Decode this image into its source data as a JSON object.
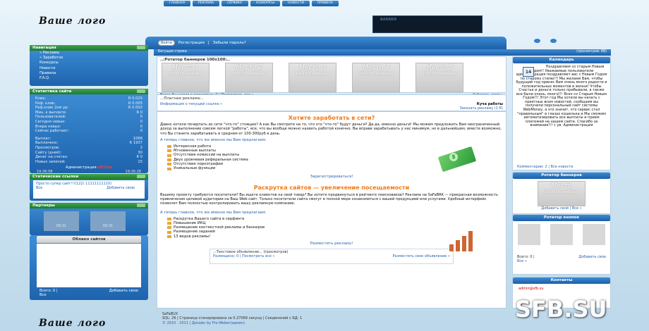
{
  "topnav": [
    "ГЛАВНАЯ",
    "РЕКЛАМА",
    "СЁРФИНГ",
    "КОНКУРСЫ",
    "НОВОСТИ",
    "ПРАВИЛА"
  ],
  "logo": "Ваше лого",
  "banner": "BANNER",
  "auth": {
    "login_btn": "Войти",
    "register": "Регистрация",
    "forgot": "Забыли пароль?"
  },
  "ticker": {
    "left": "Бегущая строка",
    "right": "(просмотров: 88)"
  },
  "nav": {
    "title": "Навигация",
    "items": [
      "» Реклама",
      "» Заработок",
      "Конкурсы",
      "Новости",
      "Правила",
      "F.A.Q."
    ]
  },
  "stats": {
    "title": "Статистика сайта",
    "rows": [
      [
        "Клик:",
        "R 0.025"
      ],
      [
        "Реф. клик:",
        "R 0.005"
      ],
      [
        "Реф.клик 2ом ур:",
        "R 0.002"
      ],
      [
        "Мин. к выплате:",
        "R 0"
      ],
      [
        "Пользователей:",
        "0"
      ],
      [
        "Сегодня новых:",
        "0"
      ],
      [
        "Вчера новых:",
        "0"
      ],
      [
        "Сейчас работает:",
        "0"
      ],
      [
        "Выплат:",
        "1066"
      ],
      [
        "Выплачено:",
        "R 1937"
      ],
      [
        "Просмотров:",
        "2"
      ],
      [
        "Сайту (дней):",
        "30"
      ],
      [
        "Денег на счетах:",
        "R 0"
      ],
      [
        "Новых записей:",
        "15"
      ]
    ],
    "admin_label": "Администрация",
    "admin_status": "off-line",
    "time_left": "19:36:58",
    "time_right": "19:26:28"
  },
  "static_links": {
    "title": "Статические ссылки",
    "link": "Просто супер сайт!!!(122) 11111111110)",
    "all": "Все",
    "add": "Добавить свою"
  },
  "partners": {
    "title": "Партнеры",
    "counter": "00:31"
  },
  "cloud": {
    "title": "Облако сайтов",
    "total": "Всего: 0 |",
    "all": "Все",
    "add": "Добавить свою"
  },
  "rotator": {
    "title": "..:Ротатор баннеров 100х100:..",
    "places": [
      "Место 1",
      "Место 2",
      "Место 3",
      "Место 4",
      "Место 5"
    ],
    "place_note": "100x100 свободно",
    "total": "Всего баннеров в ротаторах: 0 | Посмотреть все »",
    "add": "Добавить свой »"
  },
  "paid": {
    "title": "..:Платная реклама:..",
    "link": "Информация о текущей ссылке »",
    "right_title": "Куча работы",
    "order": "Заказать рекламу (1 R)"
  },
  "earn": {
    "heading": "Хотите заработать в сети?",
    "text": "Давно хотели почерпать из сети \"что-то\" стоящее? А как Вы смотрите на то, что это \"что-то\" будут деньги? Да-да, именно деньги! Мы можем предложить Вам неограниченный доход за выполнение совсем легкой \"работы\", все, что вы вообще можно назвать работой конечно. Вы вправе зарабатывать у нас минимум, но в дальнейшем, вместе возможно, что Вы станете зарабатывать в среднем от 100-300руб в день.",
    "sub": "А теперь главное, что же именно мы Вам предлагаем:",
    "items": [
      "Интересная работа",
      "Мгновенные выплаты",
      "Отсутствие комиссий на выплаты",
      "Двух уровневая реферальная система",
      "Отсутствие порнографии",
      "Уникальные функции"
    ],
    "cta": "Зарегистрироваться!"
  },
  "promo": {
    "heading": "Раскрутка сайтов — увеличение посещаемости",
    "text": "Вашему проекту требуются посетители? Вы ищете клиентов на свой товар? Вы хотите продвинуться в рейтинге поисковиков? Реклама на SaFaBRK — прекрасная возможность привлечения целевой аудитории на Ваш Web-сайт. Только посетители сайта смогут в полной мере ознакомиться с вашей продукцией или услугами. Удобный интерфейс позволит Вам полностью контролировать вашу рекламную компанию.",
    "sub": "А теперь главное, что же именно мы Вам предлагаем:",
    "items": [
      "Раскрутка Вашего сайта в серфинге",
      "Повышение ИКЦ",
      "Размещение контекстной рекламы и баннеров",
      "Размещение заданий",
      "13 видов рекламы!"
    ],
    "cta": "Разместить рекламу!"
  },
  "textads": {
    "title": "..:Текстовое объявление:.. (просмотров)",
    "placed": "Размещено: 0 | Посмотреть все »",
    "place": "Разместить свое объявление »"
  },
  "calendar": {
    "title": "Календарь",
    "day": "14",
    "news": "Поздравляем со старым Новым Годом!! Уважаемые пользователи администрация поздравляет вас с Новым Годом по старому стилю!!! Мы желаем Вам, чтобы будущий год принес Вам очень много радости и положительных моментов в жизни! Чтобы Счастье и деньги только прибывали, а также все были очень, много!!! Всех со Старым Новым Годом!!! Этот год Мы хотели вы начать с приятных всем новостей, сообщаем вы получили персональный сайт системы WebMoney, а это значит, что сервис стал \"правильным\" в глазах кошелька и Мы сможем автоматизировать все выплаты и прием платежей на нашем сайте. Спасибо за внимание!!! с ув. Администрация",
    "comments": "Комментарии: 2 | Все новости"
  },
  "rbanners": {
    "title": "Ротатор баннеров",
    "place": "Место",
    "note": "100x100 свободно",
    "add": "Добавить свой | Все »"
  },
  "rbuttons": {
    "title": "Ротатор кнопок",
    "counter": "00:31"
  },
  "rbottom": {
    "total": "Всего: 0 |",
    "add": "Добавить свое",
    "all": "Все »"
  },
  "contacts": {
    "title": "Контакты",
    "email": "admin@sfb.su"
  },
  "footer": {
    "engine": "SaFaBUX",
    "stats": "SQL: 26 | Страница сгенерирована за 0.27069 секунд | Соединений с БД: 1",
    "copy": "© 2010 - 2011 | Дизайн by Pro-Weber(админ)"
  },
  "watermark": "SFB.SU",
  "colors": {
    "accent": "#1c5fa8",
    "green": "#2f8f3c",
    "orange": "#f37a15"
  }
}
